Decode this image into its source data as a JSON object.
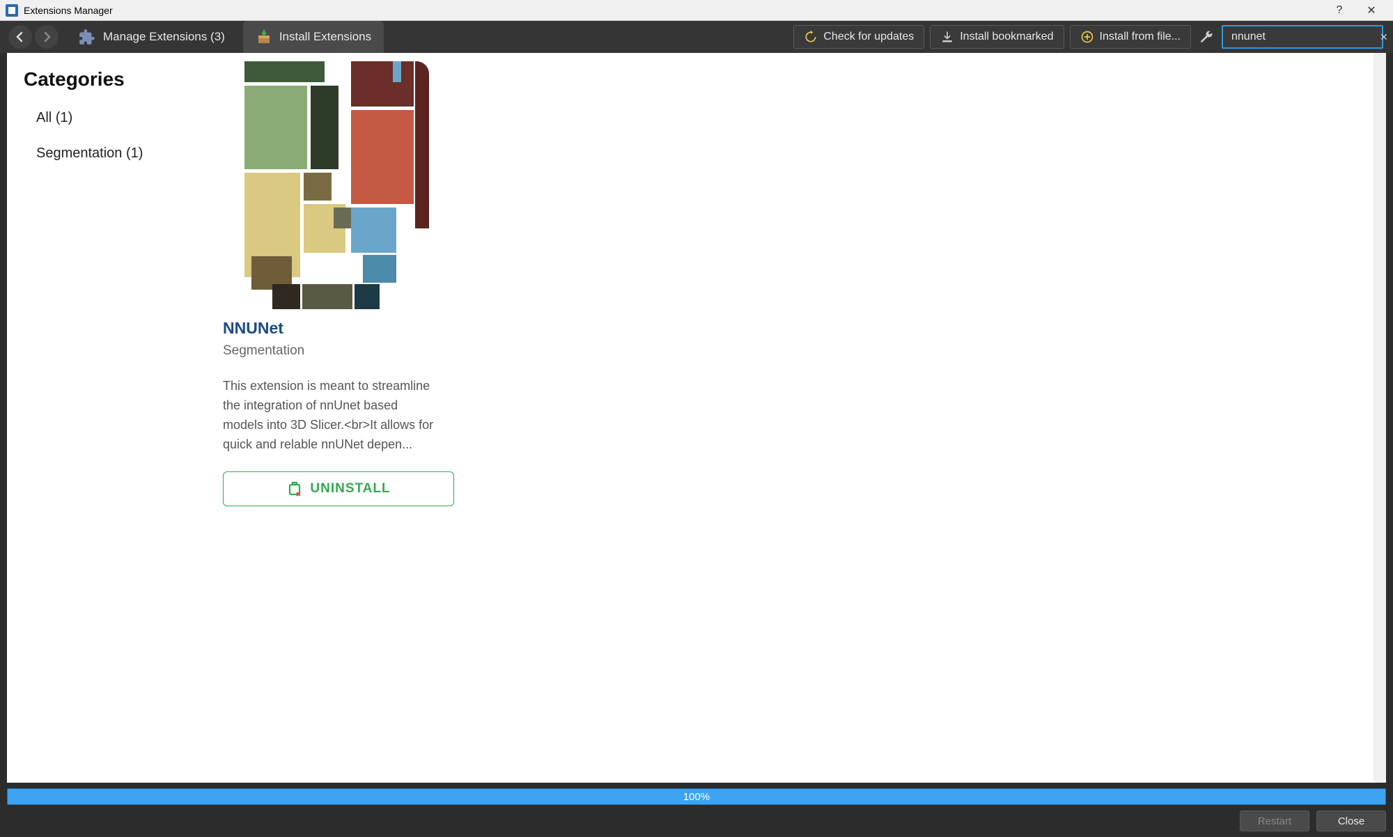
{
  "window": {
    "title": "Extensions Manager",
    "helpGlyph": "?",
    "closeGlyph": "✕"
  },
  "toolbar": {
    "tabs": [
      {
        "label": "Manage Extensions (3)",
        "active": false
      },
      {
        "label": "Install Extensions",
        "active": true
      }
    ],
    "checkUpdates": "Check for updates",
    "installBookmarked": "Install bookmarked",
    "installFromFile": "Install from file..."
  },
  "search": {
    "value": "nnunet"
  },
  "sidebar": {
    "title": "Categories",
    "items": [
      {
        "label": "All (1)"
      },
      {
        "label": "Segmentation (1)"
      }
    ]
  },
  "extension": {
    "name": "NNUNet",
    "category": "Segmentation",
    "description": "This extension is meant to streamline the integration of nnUnet based models into 3D Slicer.<br>It allows for quick and relable nnUNet depen...",
    "uninstallLabel": "UNINSTALL"
  },
  "progress": {
    "text": "100%"
  },
  "footer": {
    "restart": "Restart",
    "close": "Close"
  }
}
